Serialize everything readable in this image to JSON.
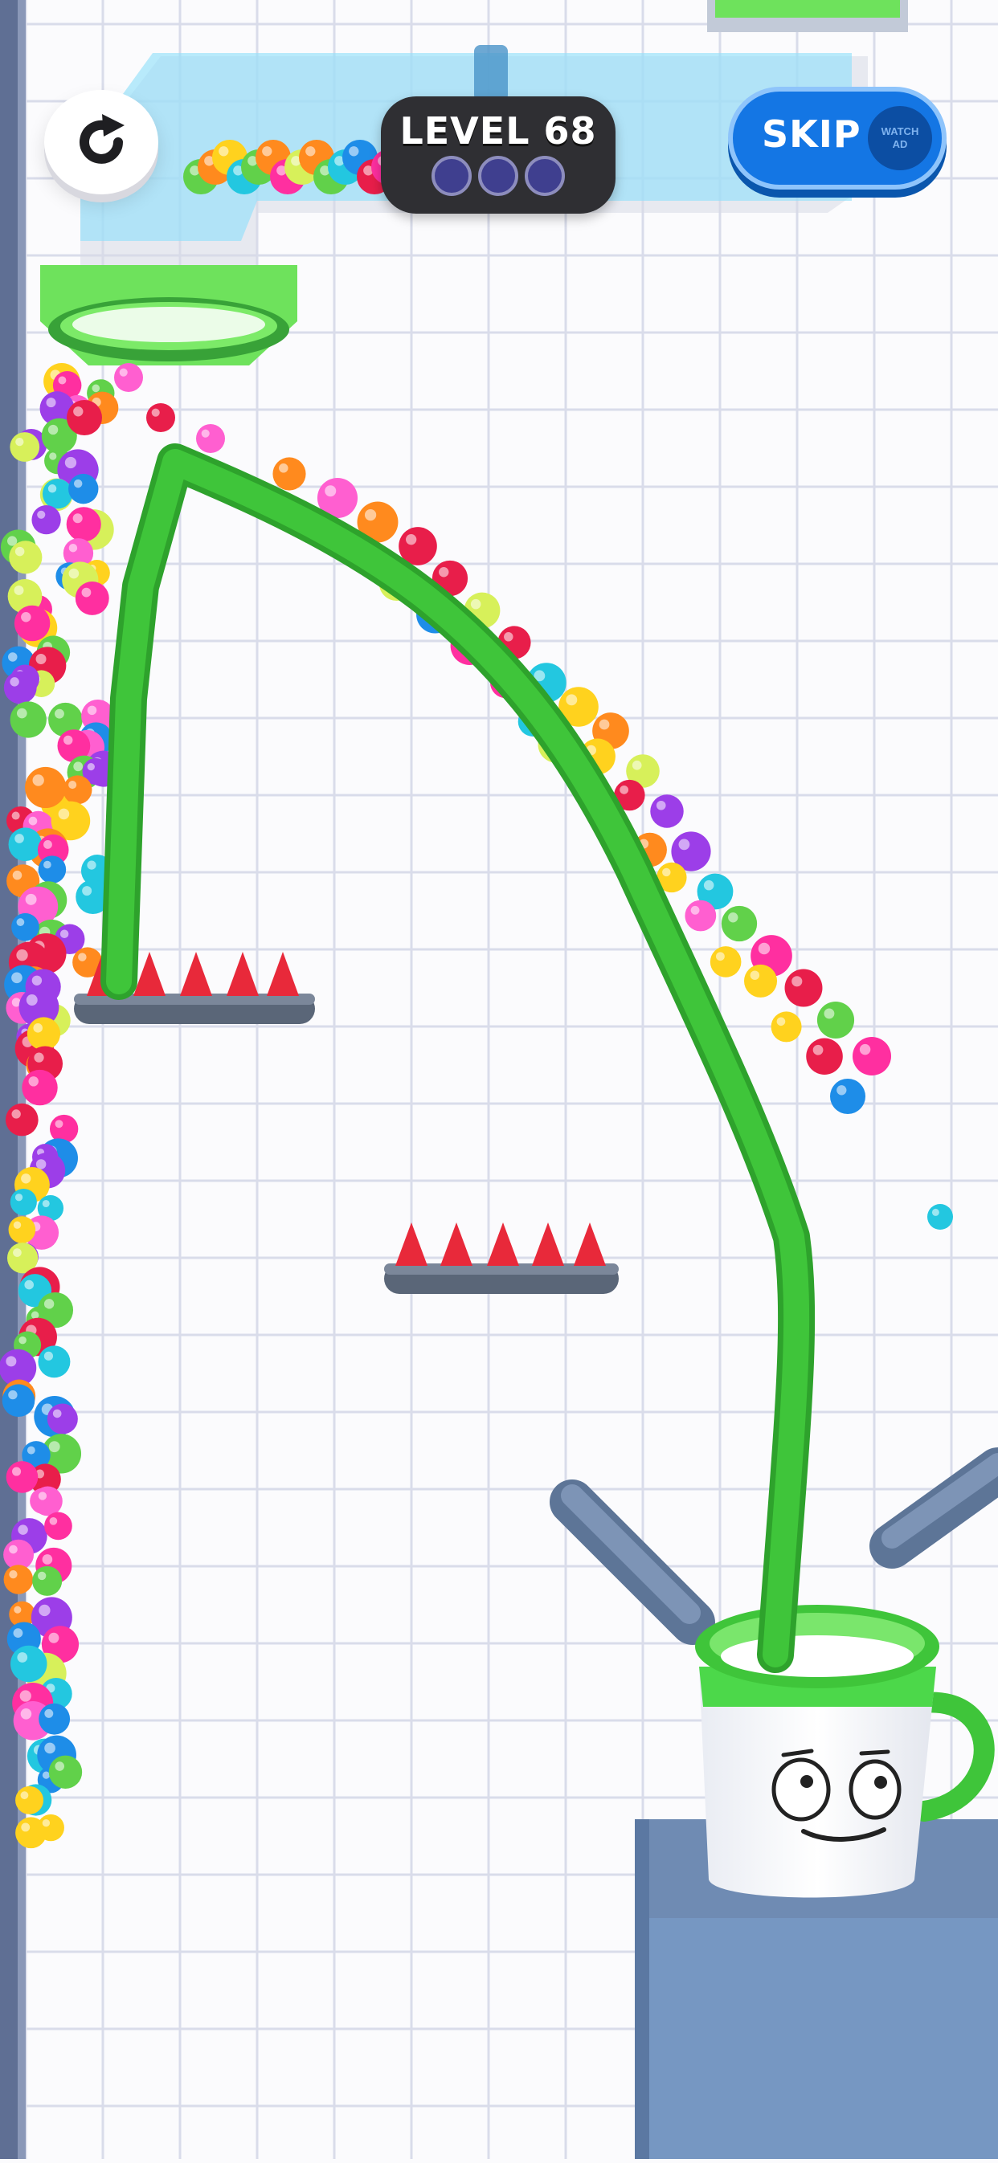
{
  "hud": {
    "level_label": "LEVEL 68",
    "skip_label": "SKIP",
    "watch_ad_line1": "WATCH",
    "watch_ad_line2": "AD",
    "progress_total": 3,
    "progress_filled": 0
  },
  "icons": {
    "restart": "restart-icon",
    "cup_face": "smiley-face"
  },
  "colors": {
    "background": "#fbfbfd",
    "grid_line": "#d9dcea",
    "drawn_line": "#3fc53a",
    "drawn_line_dark": "#2ea22c",
    "spike": "#e8293a",
    "platform": "#5a6678",
    "pipe": "#9fe6ff",
    "funnel": "#6ee25c",
    "cup_rim": "#4cd84a",
    "cup_body": "#ffffff",
    "pedestal": "#6f8bb3",
    "skip_button": "#1476e4",
    "level_box": "#2f2f33"
  },
  "ball_colors": [
    "#ff2fa0",
    "#ffd21e",
    "#23c7e0",
    "#9c3ee8",
    "#61d14a",
    "#ff8a1e",
    "#e81e4a",
    "#1e8de8",
    "#d7f05a",
    "#ff5fd0"
  ]
}
